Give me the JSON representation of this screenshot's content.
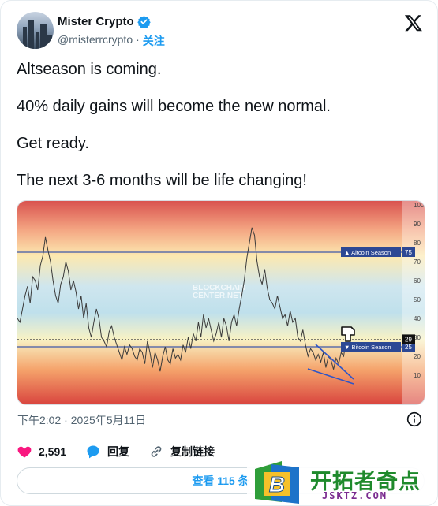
{
  "author": {
    "name": "Mister Crypto",
    "handle": "@misterrcrypto",
    "separator": "·",
    "follow_label": "关注"
  },
  "tweet": {
    "paragraphs": [
      "Altseason is coming.",
      "40% daily gains will become the new normal.",
      "Get ready.",
      "The next 3-6 months will be life changing!"
    ],
    "timestamp": "下午2:02 · 2025年5月11日"
  },
  "actions": {
    "likes": "2,591",
    "reply_label": "回复",
    "copy_label": "复制链接"
  },
  "replies_button": "查看 115 条",
  "watermark": {
    "title": "开拓者奇点",
    "url": "JSKTZ.COM",
    "letter": "B"
  },
  "chart_data": {
    "type": "line",
    "ylim": [
      0,
      100
    ],
    "yticks": [
      10,
      20,
      25,
      29,
      30,
      40,
      50,
      60,
      70,
      75,
      80,
      90,
      100
    ],
    "watermark_text": [
      "BLOCKCHAIN",
      "CENTER.NET"
    ],
    "thresholds": [
      {
        "label": "Altcoin Season",
        "value": 75
      },
      {
        "label": "Bitcoin Season",
        "value": 25
      }
    ],
    "current_value": 29,
    "series": [
      {
        "values": [
          40,
          38,
          45,
          52,
          57,
          48,
          62,
          60,
          55,
          68,
          73,
          83,
          76,
          70,
          60,
          52,
          48,
          58,
          62,
          70,
          65,
          55,
          60,
          54,
          45,
          52,
          40,
          48,
          35,
          30,
          38,
          45,
          40,
          30,
          28,
          25,
          33,
          36,
          30,
          26,
          22,
          18,
          25,
          21,
          26,
          24,
          20,
          18,
          24,
          22,
          16,
          28,
          22,
          14,
          22,
          18,
          12,
          20,
          25,
          18,
          16,
          24,
          19,
          21,
          18,
          26,
          22,
          30,
          24,
          32,
          28,
          38,
          30,
          42,
          35,
          40,
          34,
          28,
          32,
          38,
          30,
          40,
          36,
          28,
          38,
          42,
          36,
          45,
          52,
          60,
          72,
          80,
          88,
          84,
          70,
          62,
          58,
          66,
          56,
          50,
          48,
          45,
          52,
          46,
          40,
          42,
          36,
          44,
          38,
          40,
          30,
          28,
          34,
          26,
          20,
          24,
          22,
          18,
          21,
          17,
          22,
          14,
          20,
          18,
          13,
          19,
          16,
          22,
          20,
          30,
          29
        ]
      }
    ]
  },
  "colors": {
    "accent": "#1d9bf0",
    "like": "#f91880",
    "threshold_line": "#3f5aa8",
    "label_bg": "#2c4894"
  }
}
